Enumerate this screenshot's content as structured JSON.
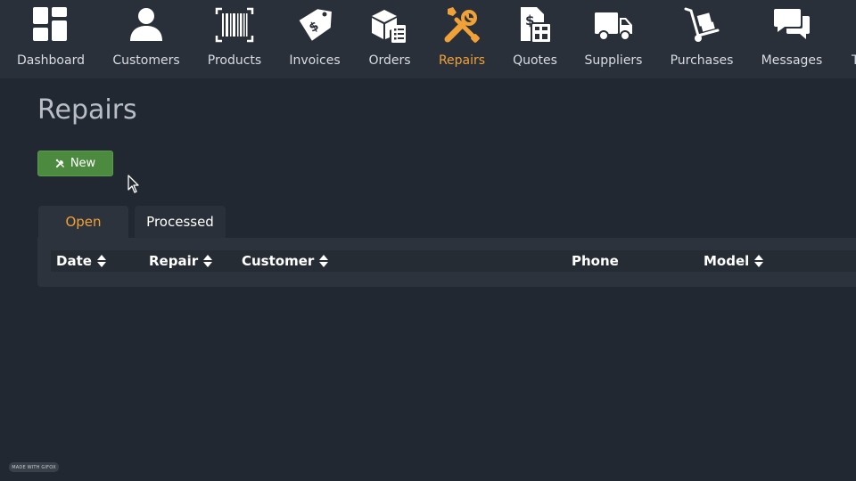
{
  "nav": {
    "items": [
      {
        "label": "Dashboard",
        "icon": "dashboard-grid-icon"
      },
      {
        "label": "Customers",
        "icon": "person-icon"
      },
      {
        "label": "Products",
        "icon": "barcode-icon"
      },
      {
        "label": "Invoices",
        "icon": "price-tag-icon"
      },
      {
        "label": "Orders",
        "icon": "box-checklist-icon"
      },
      {
        "label": "Repairs",
        "icon": "wrench-screwdriver-icon",
        "active": true
      },
      {
        "label": "Quotes",
        "icon": "document-calculator-icon"
      },
      {
        "label": "Suppliers",
        "icon": "truck-icon"
      },
      {
        "label": "Purchases",
        "icon": "hand-truck-icon"
      },
      {
        "label": "Messages",
        "icon": "chat-bubbles-icon"
      },
      {
        "label": "T",
        "icon": ""
      }
    ]
  },
  "page": {
    "title": "Repairs"
  },
  "toolbar": {
    "new_label": "New",
    "new_icon": "tools-icon"
  },
  "tabs": {
    "open": "Open",
    "processed": "Processed"
  },
  "table": {
    "columns": [
      {
        "label": "Date",
        "sortable": true
      },
      {
        "label": "Repair",
        "sortable": true
      },
      {
        "label": "Customer",
        "sortable": true
      },
      {
        "label": "Phone",
        "sortable": false
      },
      {
        "label": "Model",
        "sortable": true
      }
    ]
  },
  "colors": {
    "accent": "#f0a137",
    "background": "#222831",
    "nav_background": "#2a3039",
    "button_green": "#4c8b3f"
  },
  "watermark": {
    "text": "MADE WITH GIFOX"
  }
}
